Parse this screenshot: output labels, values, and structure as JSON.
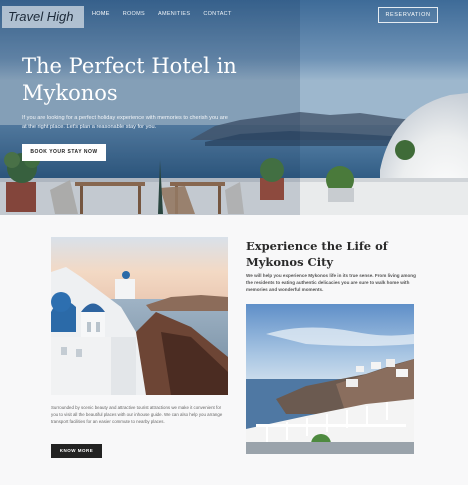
{
  "brand": {
    "name": "Travel High"
  },
  "nav": {
    "items": [
      {
        "label": "HOME",
        "active": true
      },
      {
        "label": "ROOMS",
        "active": false
      },
      {
        "label": "AMENITIES",
        "active": false
      },
      {
        "label": "CONTACT",
        "active": false
      }
    ],
    "reservation_label": "RESERVATION"
  },
  "hero": {
    "title": "The Perfect Hotel in Mykonos",
    "subtitle": "If you are looking for a perfect holiday experience with memories to cherish you are at the right place. Let's plan a reasonable stay for you.",
    "cta_label": "BOOK YOUR STAY NOW"
  },
  "about": {
    "title": "Experience the Life of Mykonos City",
    "body": "We will help you experience Mykonos life in its true sense. From living among the residents to eating authentic delicacies you are sure to walk home with memories and wonderful moments.",
    "left_text": "Surrounded by scenic beauty and attractive tourist attractions we make it convenient for you to visit all the beautiful places with our inhouse guide. We can also help you arrange transport facilities for an easier commute to nearby places.",
    "button_label": "KNOW MORE"
  },
  "colors": {
    "accent_dark": "#222222",
    "hero_sky": "#3d6a97",
    "page_bg": "#f8f8f9"
  }
}
